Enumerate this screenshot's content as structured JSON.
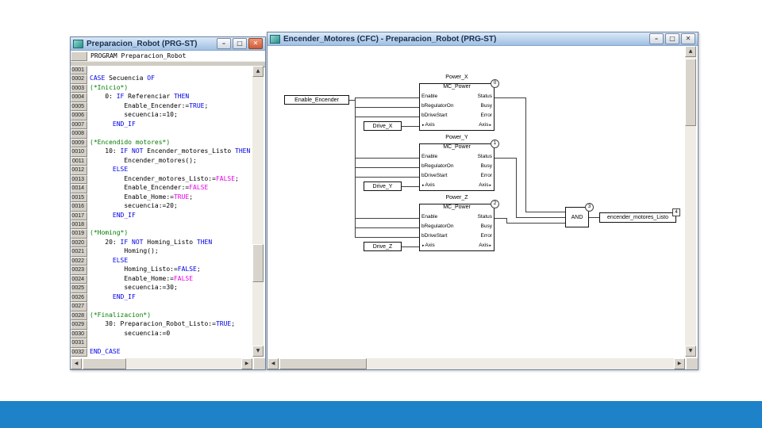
{
  "slide": {
    "band_color": "#1e82c8"
  },
  "icons": {
    "minimize": "–",
    "maximize": "□",
    "close": "✕",
    "up": "▲",
    "down": "▼",
    "left": "◀",
    "right": "▶",
    "inout": "▸"
  },
  "left_window": {
    "title": "Preparacion_Robot (PRG-ST)",
    "declaration": "PROGRAM Preparacion_Robot",
    "code_lines": [
      {
        "n": "0001",
        "s": []
      },
      {
        "n": "0002",
        "s": [
          [
            "CASE",
            "k"
          ],
          [
            " Secuencia "
          ],
          [
            "OF",
            "k"
          ]
        ]
      },
      {
        "n": "0003",
        "s": [
          [
            "(*Inicio*)",
            "c"
          ]
        ]
      },
      {
        "n": "0004",
        "s": [
          [
            "    0: "
          ],
          [
            "IF",
            "k"
          ],
          [
            " Referenciar "
          ],
          [
            "THEN",
            "k"
          ]
        ]
      },
      {
        "n": "0005",
        "s": [
          [
            "         Enable_Encender:="
          ],
          [
            "TRUE",
            "k"
          ],
          [
            ";"
          ]
        ]
      },
      {
        "n": "0006",
        "s": [
          [
            "         secuencia:=10;"
          ]
        ]
      },
      {
        "n": "0007",
        "s": [
          [
            "      "
          ],
          [
            "END_IF",
            "k"
          ]
        ]
      },
      {
        "n": "0008",
        "s": []
      },
      {
        "n": "0009",
        "s": [
          [
            "(*Encendido motores*)",
            "c"
          ]
        ]
      },
      {
        "n": "0010",
        "s": [
          [
            "    10: "
          ],
          [
            "IF",
            "k"
          ],
          [
            " "
          ],
          [
            "NOT",
            "k"
          ],
          [
            " Encender_motores_Listo "
          ],
          [
            "THEN",
            "k"
          ]
        ]
      },
      {
        "n": "0011",
        "s": [
          [
            "         Encender_motores();"
          ]
        ]
      },
      {
        "n": "0012",
        "s": [
          [
            "      "
          ],
          [
            "ELSE",
            "k"
          ]
        ]
      },
      {
        "n": "0013",
        "s": [
          [
            "         Encender_motores_Listo:="
          ],
          [
            "FALSE",
            "p"
          ],
          [
            ";"
          ]
        ]
      },
      {
        "n": "0014",
        "s": [
          [
            "         Enable_Encender:="
          ],
          [
            "FALSE",
            "p"
          ]
        ]
      },
      {
        "n": "0015",
        "s": [
          [
            "         Enable_Home:="
          ],
          [
            "TRUE",
            "p"
          ],
          [
            ";"
          ]
        ]
      },
      {
        "n": "0016",
        "s": [
          [
            "         secuencia:=20;"
          ]
        ]
      },
      {
        "n": "0017",
        "s": [
          [
            "      "
          ],
          [
            "END_IF",
            "k"
          ]
        ]
      },
      {
        "n": "0018",
        "s": []
      },
      {
        "n": "0019",
        "s": [
          [
            "(*Homing*)",
            "c"
          ]
        ]
      },
      {
        "n": "0020",
        "s": [
          [
            "    20: "
          ],
          [
            "IF",
            "k"
          ],
          [
            " "
          ],
          [
            "NOT",
            "k"
          ],
          [
            " Homing_Listo "
          ],
          [
            "THEN",
            "k"
          ]
        ]
      },
      {
        "n": "0021",
        "s": [
          [
            "         Homing();"
          ]
        ]
      },
      {
        "n": "0022",
        "s": [
          [
            "      "
          ],
          [
            "ELSE",
            "k"
          ]
        ]
      },
      {
        "n": "0023",
        "s": [
          [
            "         Homing_Listo:="
          ],
          [
            "FALSE",
            "k"
          ],
          [
            ";"
          ]
        ]
      },
      {
        "n": "0024",
        "s": [
          [
            "         Enable_Home:="
          ],
          [
            "FALSE",
            "p"
          ]
        ]
      },
      {
        "n": "0025",
        "s": [
          [
            "         secuencia:=30;"
          ]
        ]
      },
      {
        "n": "0026",
        "s": [
          [
            "      "
          ],
          [
            "END_IF",
            "k"
          ]
        ]
      },
      {
        "n": "0027",
        "s": []
      },
      {
        "n": "0028",
        "s": [
          [
            "(*Finalizacion*)",
            "c"
          ]
        ]
      },
      {
        "n": "0029",
        "s": [
          [
            "    30: Preparacion_Robot_Listo:="
          ],
          [
            "TRUE",
            "k"
          ],
          [
            ";"
          ]
        ]
      },
      {
        "n": "0030",
        "s": [
          [
            "         secuencia:=0"
          ]
        ]
      },
      {
        "n": "0031",
        "s": []
      },
      {
        "n": "0032",
        "s": [
          [
            "END_CASE",
            "k"
          ]
        ]
      }
    ]
  },
  "right_window": {
    "title": "Encender_Motores (CFC) - Preparacion_Robot (PRG-ST)",
    "cfc": {
      "main_input": "Enable_Encender",
      "drive_inputs": [
        "Drive_X",
        "Drive_Y",
        "Drive_Z"
      ],
      "blocks": [
        {
          "instance": "Power_X",
          "type": "MC_Power",
          "order": "0",
          "in": [
            "Enable",
            "bRegulatorOn",
            "bDriveStart",
            "Axis"
          ],
          "out": [
            "Status",
            "Busy",
            "Error",
            "Axis"
          ]
        },
        {
          "instance": "Power_Y",
          "type": "MC_Power",
          "order": "1",
          "in": [
            "Enable",
            "bRegulatorOn",
            "bDriveStart",
            "Axis"
          ],
          "out": [
            "Status",
            "Busy",
            "Error",
            "Axis"
          ]
        },
        {
          "instance": "Power_Z",
          "type": "MC_Power",
          "order": "2",
          "in": [
            "Enable",
            "bRegulatorOn",
            "bDriveStart",
            "Axis"
          ],
          "out": [
            "Status",
            "Busy",
            "Error",
            "Axis"
          ]
        }
      ],
      "and_block": {
        "label": "AND",
        "order": "3"
      },
      "output": {
        "label": "encender_motores_Listo",
        "order": "4"
      }
    }
  }
}
